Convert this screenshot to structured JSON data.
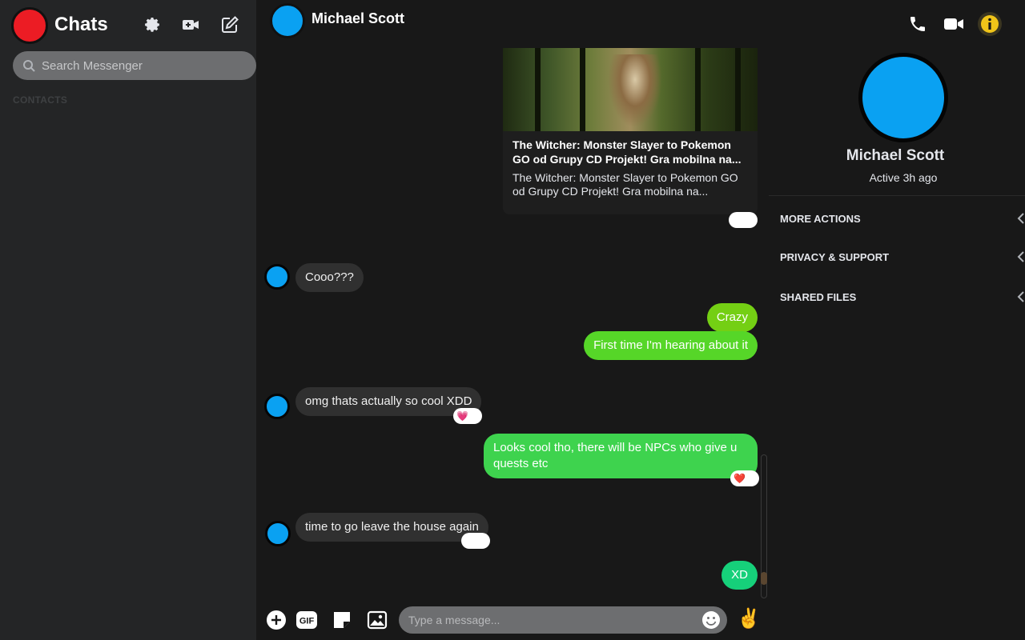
{
  "sidebar": {
    "title": "Chats",
    "search_placeholder": "Search Messenger",
    "contacts_label": "CONTACTS",
    "icons": [
      "settings-gear-icon",
      "new-video-room-icon",
      "compose-icon"
    ]
  },
  "chat": {
    "peer_name": "Michael Scott",
    "link_preview": {
      "title": "The Witcher: Monster Slayer to Pokemon GO od Grupy CD Projekt! Gra mobilna na...",
      "description": "The Witcher: Monster Slayer to Pokemon GO od Grupy CD Projekt! Gra mobilna na...",
      "reaction": "😮"
    },
    "messages": [
      {
        "direction": "in",
        "text": "Cooo???",
        "reaction": ""
      },
      {
        "direction": "out",
        "text": "Crazy",
        "reaction": ""
      },
      {
        "direction": "out",
        "text": "First time I'm hearing about it",
        "reaction": ""
      },
      {
        "direction": "in",
        "text": "omg thats actually so cool XDD",
        "reaction": "💗"
      },
      {
        "direction": "out",
        "text": "Looks cool tho, there will be NPCs who give u quests etc",
        "reaction": "❤️"
      },
      {
        "direction": "in",
        "text": "time to go leave the house again",
        "reaction": "😆"
      },
      {
        "direction": "out",
        "text": "XD",
        "reaction": ""
      }
    ],
    "composer": {
      "placeholder": "Type a message...",
      "gif_label": "GIF",
      "quick_reaction": "✌️"
    }
  },
  "info_panel": {
    "name": "Michael Scott",
    "status": "Active 3h ago",
    "sections": [
      "MORE ACTIONS",
      "PRIVACY & SUPPORT",
      "SHARED FILES"
    ]
  },
  "colors": {
    "sidebar_bg": "#242526",
    "chat_bg": "#181818",
    "my_avatar": "#ec1c24",
    "peer_avatar": "#0aa1f2",
    "bubble_in": "#303030",
    "bubble_out_top": "#74cf14",
    "bubble_out_bottom": "#16d07a",
    "info_button": "#f0c419"
  }
}
